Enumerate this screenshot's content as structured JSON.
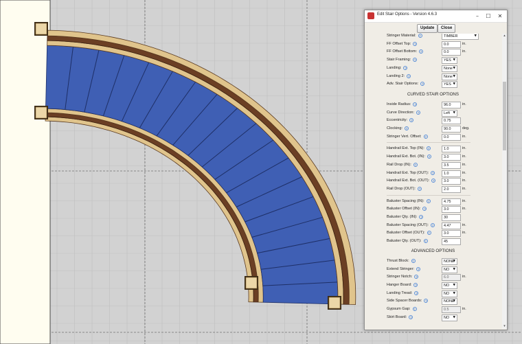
{
  "window": {
    "title": "Edit Stair Options - Version 4.6.3",
    "minimize_icon": "minimize-icon",
    "maximize_icon": "maximize-icon",
    "close_icon": "close-icon"
  },
  "toolbar": {
    "update_label": "Update",
    "close_label": "Close"
  },
  "colors": {
    "tread": "#3f5fb4",
    "stringer_dark": "#6b3f24",
    "stringer_light": "#e0c48c",
    "canvas_bg": "#d2d2d2",
    "wall": "#fffdf0"
  },
  "general_rows": [
    {
      "label": "Stringer Material:",
      "type": "select",
      "value": "TIMBER"
    },
    {
      "label": "FF Offset Top:",
      "type": "field",
      "value": "0.0",
      "unit": "in."
    },
    {
      "label": "FF Offset Bottom:",
      "type": "field",
      "value": "0.0",
      "unit": "in."
    },
    {
      "label": "Stair Framing:",
      "type": "select",
      "value": "YES"
    },
    {
      "label": "Landing:",
      "type": "select",
      "value": "None"
    },
    {
      "label": "Landing 2:",
      "type": "select",
      "value": "None"
    },
    {
      "label": "Adv. Stair Options:",
      "type": "select",
      "value": "YES"
    }
  ],
  "curved_section": {
    "title": "CURVED STAIR OPTIONS"
  },
  "curved_rows": [
    {
      "label": "Inside Radius:",
      "type": "field",
      "value": "96.0",
      "unit": "in."
    },
    {
      "label": "Curve Direction:",
      "type": "select",
      "value": "Left"
    },
    {
      "label": "Eccentricity:",
      "type": "field",
      "value": "0.75",
      "unit": ""
    },
    {
      "label": "Clocking:",
      "type": "field",
      "value": "90.0",
      "unit": "deg."
    },
    {
      "label": "Stringer Vert. Offset:",
      "type": "field",
      "value": "0.0",
      "unit": "in."
    }
  ],
  "handrail_rows": [
    {
      "label": "Handrail Ext. Top (IN):",
      "type": "field",
      "value": "1.0",
      "unit": "in."
    },
    {
      "label": "Handrail Ext. Bot. (IN):",
      "type": "field",
      "value": "3.0",
      "unit": "in."
    },
    {
      "label": "Rail Drop (IN):",
      "type": "field",
      "value": "3.5",
      "unit": "in."
    },
    {
      "label": "Handrail Ext. Top (OUT):",
      "type": "field",
      "value": "1.0",
      "unit": "in."
    },
    {
      "label": "Handrail Ext. Bot. (OUT):",
      "type": "field",
      "value": "3.0",
      "unit": "in."
    },
    {
      "label": "Rail Drop (OUT):",
      "type": "field",
      "value": "2.0",
      "unit": "in."
    }
  ],
  "baluster_rows": [
    {
      "label": "Baluster Spacing (IN):",
      "type": "field",
      "value": "4.75",
      "unit": "in."
    },
    {
      "label": "Baluster Offset (IN):",
      "type": "field",
      "value": "3.0",
      "unit": "in."
    },
    {
      "label": "Baluster Qty. (IN):",
      "type": "field",
      "value": "30",
      "unit": ""
    },
    {
      "label": "Baluster Spacing (OUT):",
      "type": "field",
      "value": "4.47",
      "unit": "in."
    },
    {
      "label": "Baluster Offset (OUT):",
      "type": "field",
      "value": "3.0",
      "unit": "in."
    },
    {
      "label": "Baluster Qty. (OUT):",
      "type": "field",
      "value": "45",
      "unit": ""
    }
  ],
  "advanced_section": {
    "title": "ADVANCED OPTIONS"
  },
  "advanced_rows": [
    {
      "label": "Thrust Block:",
      "type": "select",
      "value": "NONE"
    },
    {
      "label": "Extend Stringer:",
      "type": "select",
      "value": "NO"
    },
    {
      "label": "Stringer Notch:",
      "type": "field",
      "value": "6.0",
      "unit": "in.",
      "disabled": true
    },
    {
      "label": "Hanger Board:",
      "type": "select",
      "value": "NO"
    },
    {
      "label": "Landing Tread:",
      "type": "select",
      "value": "NO"
    },
    {
      "label": "Side Spacer Boards:",
      "type": "select",
      "value": "NONE"
    },
    {
      "label": "Gypsum Gap:",
      "type": "field",
      "value": "0.5",
      "unit": "in.",
      "disabled": true
    },
    {
      "label": "Skirt Board:",
      "type": "select",
      "value": "NO"
    }
  ]
}
